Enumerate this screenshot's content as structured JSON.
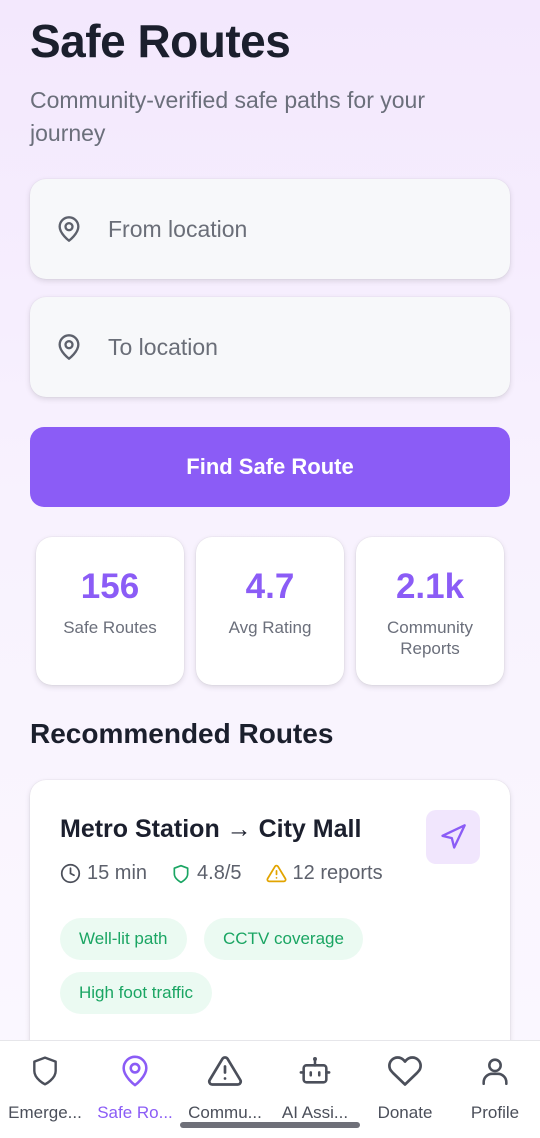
{
  "header": {
    "title": "Safe Routes",
    "subtitle": "Community-verified safe paths for your journey"
  },
  "search": {
    "from_placeholder": "From location",
    "to_placeholder": "To location",
    "find_label": "Find Safe Route"
  },
  "stats": [
    {
      "value": "156",
      "label": "Safe Routes"
    },
    {
      "value": "4.7",
      "label": "Avg Rating"
    },
    {
      "value": "2.1k",
      "label": "Community Reports"
    }
  ],
  "recommended": {
    "title": "Recommended Routes",
    "routes": [
      {
        "name": "Metro Station → City Mall",
        "duration": "15 min",
        "rating": "4.8/5",
        "reports": "12 reports",
        "tags": [
          "Well-lit path",
          "CCTV coverage",
          "High foot traffic"
        ]
      }
    ]
  },
  "bottom_nav": [
    {
      "label": "Emerge...",
      "icon": "shield-icon"
    },
    {
      "label": "Safe Ro...",
      "icon": "map-pin-icon",
      "active": true
    },
    {
      "label": "Commu...",
      "icon": "warning-icon"
    },
    {
      "label": "AI Assi...",
      "icon": "robot-icon"
    },
    {
      "label": "Donate",
      "icon": "heart-icon"
    },
    {
      "label": "Profile",
      "icon": "user-icon"
    }
  ],
  "colors": {
    "accent": "#8b5cf6",
    "tag_bg": "#ebfaf2",
    "tag_text": "#1aa563",
    "warning": "#e2a400"
  }
}
